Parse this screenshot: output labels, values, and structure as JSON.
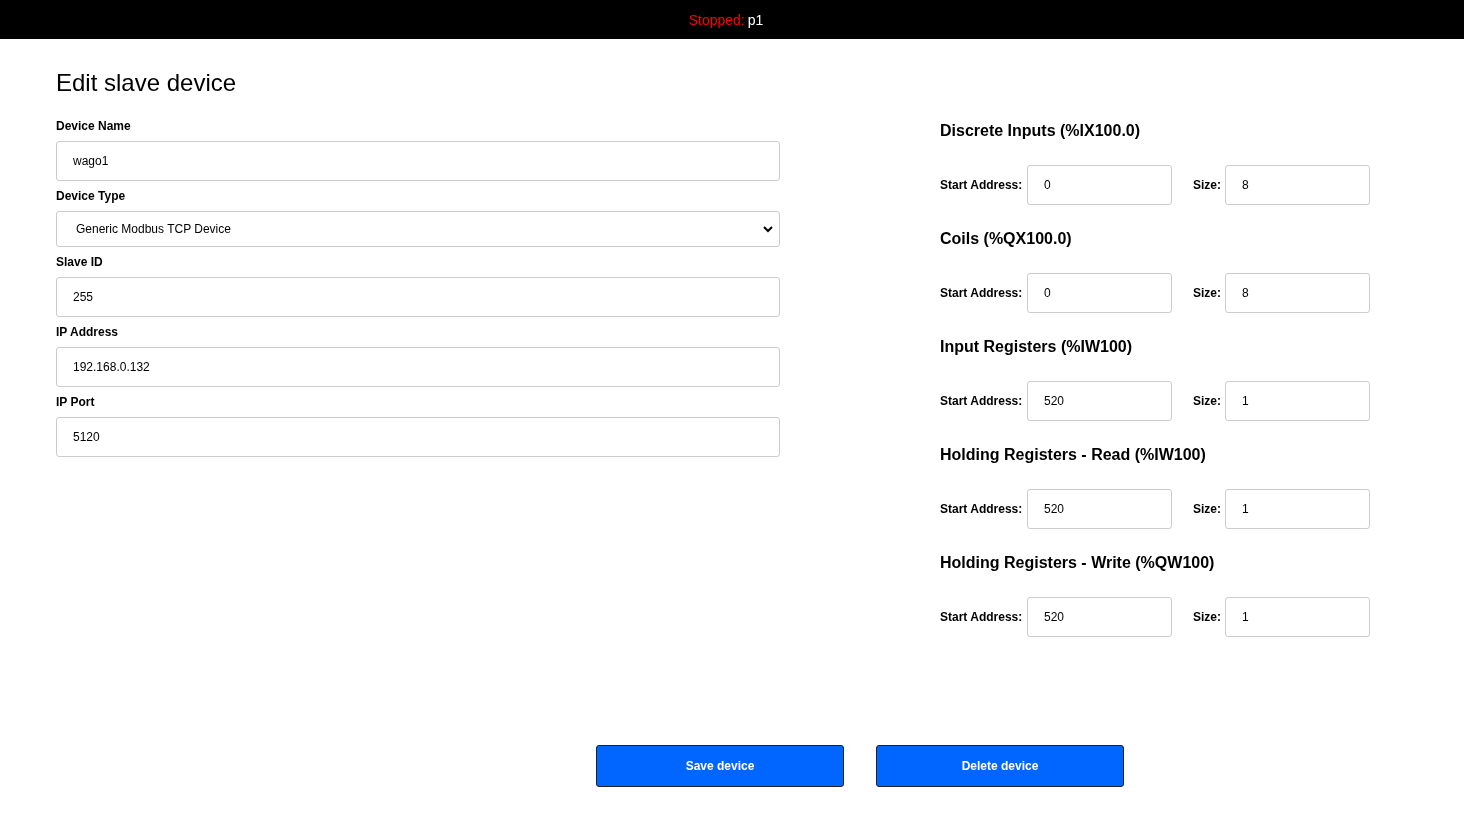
{
  "status_bar": {
    "state_label": "Stopped:",
    "program": "p1"
  },
  "title": "Edit slave device",
  "device_fields": [
    {
      "kind": "text",
      "label": "Device Name",
      "value": "wago1"
    },
    {
      "kind": "select",
      "label": "Device Type",
      "value": "Generic Modbus TCP Device"
    },
    {
      "kind": "text",
      "label": "Slave ID",
      "value": "255"
    },
    {
      "kind": "text",
      "label": "IP Address",
      "value": "192.168.0.132"
    },
    {
      "kind": "text",
      "label": "IP Port",
      "value": "5120"
    }
  ],
  "register_groups": [
    {
      "heading": "Discrete Inputs (%IX100.0)",
      "start_label": "Start Address:",
      "start_value": "0",
      "size_label": "Size:",
      "size_value": "8"
    },
    {
      "heading": "Coils (%QX100.0)",
      "start_label": "Start Address:",
      "start_value": "0",
      "size_label": "Size:",
      "size_value": "8"
    },
    {
      "heading": "Input Registers (%IW100)",
      "start_label": "Start Address:",
      "start_value": "520",
      "size_label": "Size:",
      "size_value": "1"
    },
    {
      "heading": "Holding Registers - Read (%IW100)",
      "start_label": "Start Address:",
      "start_value": "520",
      "size_label": "Size:",
      "size_value": "1"
    },
    {
      "heading": "Holding Registers - Write (%QW100)",
      "start_label": "Start Address:",
      "start_value": "520",
      "size_label": "Size:",
      "size_value": "1"
    }
  ],
  "buttons": [
    "Save device",
    "Delete device"
  ]
}
